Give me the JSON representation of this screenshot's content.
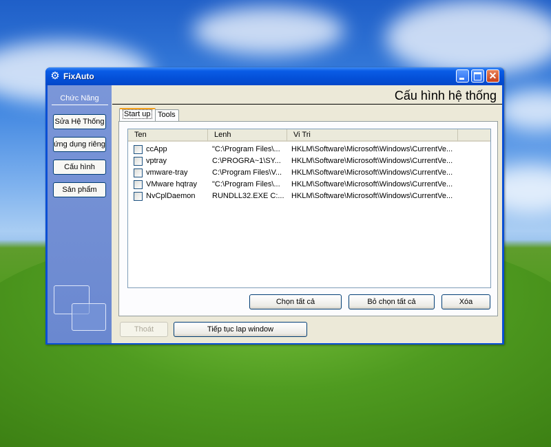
{
  "window": {
    "title": "FixAuto",
    "minimize_label": "",
    "maximize_label": "",
    "close_label": "✕"
  },
  "sidebar": {
    "title": "Chức Năng",
    "items": [
      {
        "label": "Sửa Hệ Thống"
      },
      {
        "label": "ứng dụng riêng"
      },
      {
        "label": "Cấu hình"
      },
      {
        "label": "Sản phẩm"
      }
    ]
  },
  "header": {
    "title": "Cấu hình hệ thống"
  },
  "tabs": [
    {
      "label": "Start up",
      "active": true
    },
    {
      "label": "Tools",
      "active": false
    }
  ],
  "table": {
    "columns": [
      "Ten",
      "Lenh",
      "Vi Tri"
    ],
    "rows": [
      {
        "name": "ccApp",
        "command": "\"C:\\Program Files\\...",
        "location": "HKLM\\Software\\Microsoft\\Windows\\CurrentVe...",
        "checked": false
      },
      {
        "name": "vptray",
        "command": "C:\\PROGRA~1\\SY...",
        "location": "HKLM\\Software\\Microsoft\\Windows\\CurrentVe...",
        "checked": false
      },
      {
        "name": "vmware-tray",
        "command": "C:\\Program Files\\V...",
        "location": "HKLM\\Software\\Microsoft\\Windows\\CurrentVe...",
        "checked": false
      },
      {
        "name": "VMware hqtray",
        "command": "\"C:\\Program Files\\...",
        "location": "HKLM\\Software\\Microsoft\\Windows\\CurrentVe...",
        "checked": false
      },
      {
        "name": "NvCplDaemon",
        "command": "RUNDLL32.EXE C:...",
        "location": "HKLM\\Software\\Microsoft\\Windows\\CurrentVe...",
        "checked": false
      }
    ]
  },
  "actions": {
    "select_all": "Chọn tất cả",
    "deselect_all": "Bỏ chọn tất cả",
    "delete": "Xóa"
  },
  "footer": {
    "exit": "Thoát",
    "continue": "Tiếp tục lap window"
  },
  "colors": {
    "titlebar": "#0450d8",
    "sidebar": "#7b96d8",
    "tab_highlight": "#f5a019"
  },
  "icons": {
    "app": "gear-icon",
    "minimize": "minimize-icon",
    "maximize": "maximize-icon",
    "close": "close-icon"
  }
}
